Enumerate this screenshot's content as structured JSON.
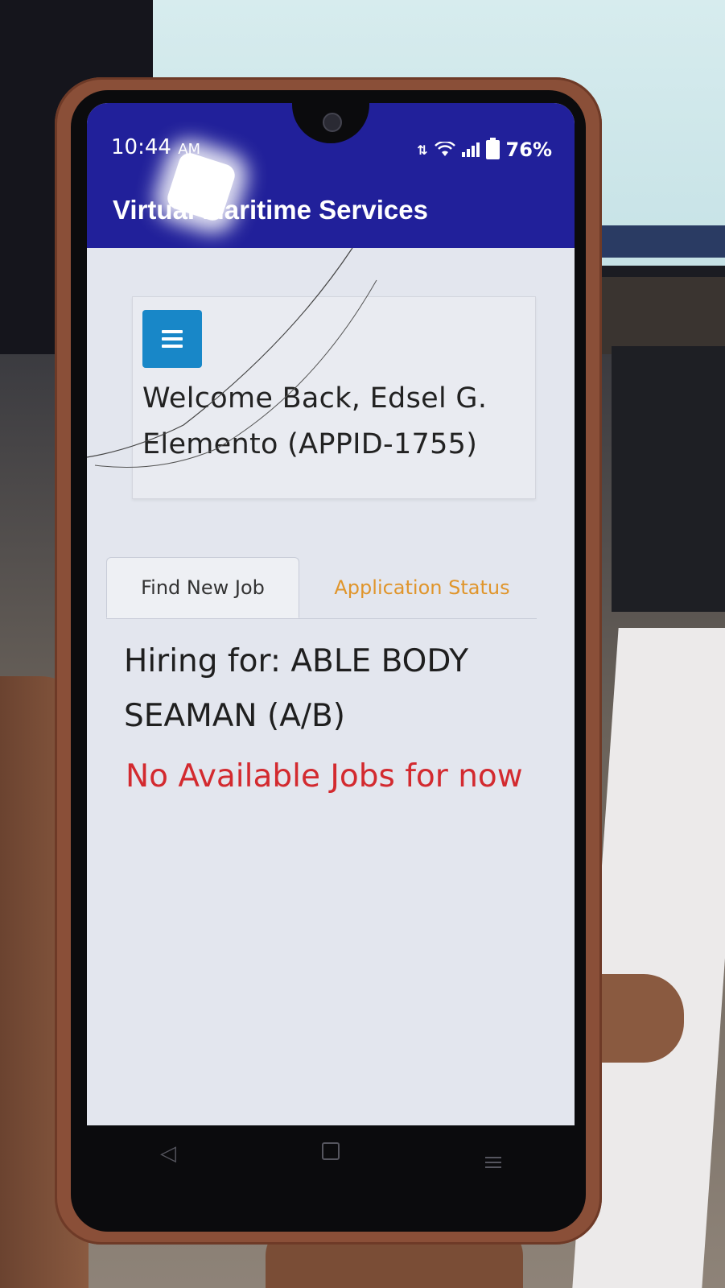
{
  "status_bar": {
    "time": "10:44",
    "time_suffix": "AM",
    "battery": "76%"
  },
  "app": {
    "title": "Virtual Maritime Services"
  },
  "welcome": {
    "text": "Welcome Back, Edsel G. Elemento (APPID-1755)"
  },
  "tabs": [
    {
      "label": "Find New Job",
      "active": true
    },
    {
      "label": "Application Status",
      "active": false
    }
  ],
  "content": {
    "hiring": "Hiring for: ABLE BODY SEAMAN (A/B)",
    "message": "No Available Jobs for now"
  },
  "colors": {
    "app_bar": "#21209a",
    "menu_button": "#1887c8",
    "inactive_tab": "#e0952b",
    "error_text": "#d32a2f"
  },
  "icons": {
    "menu": "hamburger-icon",
    "wifi": "wifi-icon",
    "signal": "signal-icon",
    "battery": "battery-icon",
    "nav_back": "back-icon",
    "nav_home": "home-icon",
    "nav_recents": "recents-icon"
  }
}
